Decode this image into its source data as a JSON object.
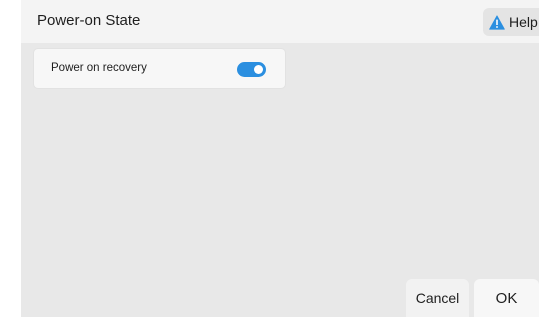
{
  "dialog": {
    "title": "Power-on State",
    "help_label": "Help",
    "help_icon": "warning-triangle-icon",
    "accent_color": "#2b8fe0"
  },
  "settings": [
    {
      "label": "Power on recovery",
      "enabled": true
    }
  ],
  "footer": {
    "cancel_label": "Cancel",
    "ok_label": "OK"
  }
}
